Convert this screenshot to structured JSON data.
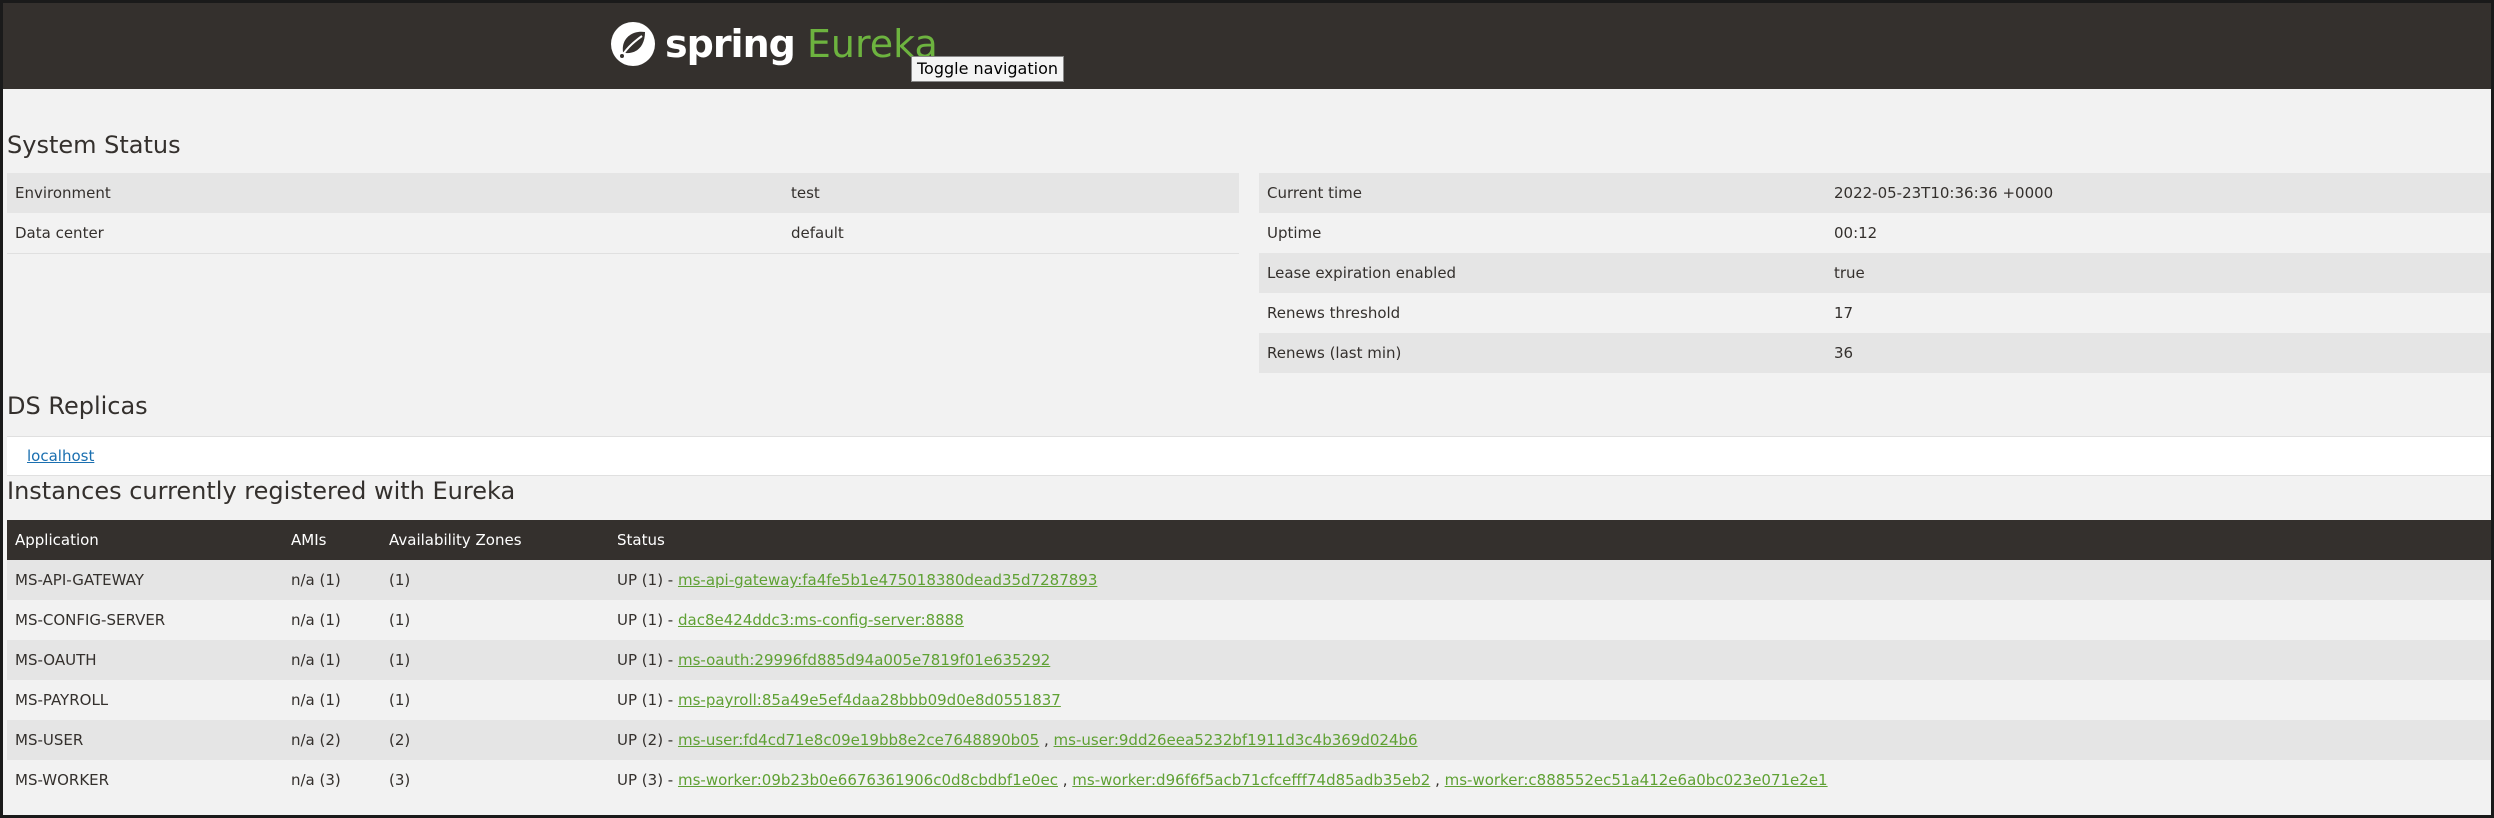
{
  "header": {
    "brand_spring": "spring",
    "brand_eureka": "Eureka",
    "toggle_label": "Toggle navigation"
  },
  "system_status": {
    "title": "System Status",
    "left": [
      {
        "label": "Environment",
        "value": "test"
      },
      {
        "label": "Data center",
        "value": "default"
      }
    ],
    "right": [
      {
        "label": "Current time",
        "value": "2022-05-23T10:36:36 +0000"
      },
      {
        "label": "Uptime",
        "value": "00:12"
      },
      {
        "label": "Lease expiration enabled",
        "value": "true"
      },
      {
        "label": "Renews threshold",
        "value": "17"
      },
      {
        "label": "Renews (last min)",
        "value": "36"
      }
    ]
  },
  "replicas": {
    "title": "DS Replicas",
    "items": [
      "localhost"
    ]
  },
  "instances": {
    "title": "Instances currently registered with Eureka",
    "columns": [
      "Application",
      "AMIs",
      "Availability Zones",
      "Status"
    ],
    "rows": [
      {
        "app": "MS-API-GATEWAY",
        "amis": "n/a (1)",
        "zones": "(1)",
        "status_prefix": "UP (1) - ",
        "links": [
          "ms-api-gateway:fa4fe5b1e475018380dead35d7287893"
        ]
      },
      {
        "app": "MS-CONFIG-SERVER",
        "amis": "n/a (1)",
        "zones": "(1)",
        "status_prefix": "UP (1) - ",
        "links": [
          "dac8e424ddc3:ms-config-server:8888"
        ]
      },
      {
        "app": "MS-OAUTH",
        "amis": "n/a (1)",
        "zones": "(1)",
        "status_prefix": "UP (1) - ",
        "links": [
          "ms-oauth:29996fd885d94a005e7819f01e635292"
        ]
      },
      {
        "app": "MS-PAYROLL",
        "amis": "n/a (1)",
        "zones": "(1)",
        "status_prefix": "UP (1) - ",
        "links": [
          "ms-payroll:85a49e5ef4daa28bbb09d0e8d0551837"
        ]
      },
      {
        "app": "MS-USER",
        "amis": "n/a (2)",
        "zones": "(2)",
        "status_prefix": "UP (2) - ",
        "links": [
          "ms-user:fd4cd71e8c09e19bb8e2ce7648890b05",
          "ms-user:9dd26eea5232bf1911d3c4b369d024b6"
        ]
      },
      {
        "app": "MS-WORKER",
        "amis": "n/a (3)",
        "zones": "(3)",
        "status_prefix": "UP (3) - ",
        "links": [
          "ms-worker:09b23b0e6676361906c0d8cbdbf1e0ec",
          "ms-worker:d96f6f5acb71cfcefff74d85adb35eb2",
          "ms-worker:c888552ec51a412e6a0bc023e071e2e1"
        ]
      }
    ],
    "link_separator": " , "
  },
  "colors": {
    "navbar": "#34302d",
    "accent": "#6db33f",
    "link_green": "#5fa134",
    "link_blue": "#1a6fb0"
  }
}
